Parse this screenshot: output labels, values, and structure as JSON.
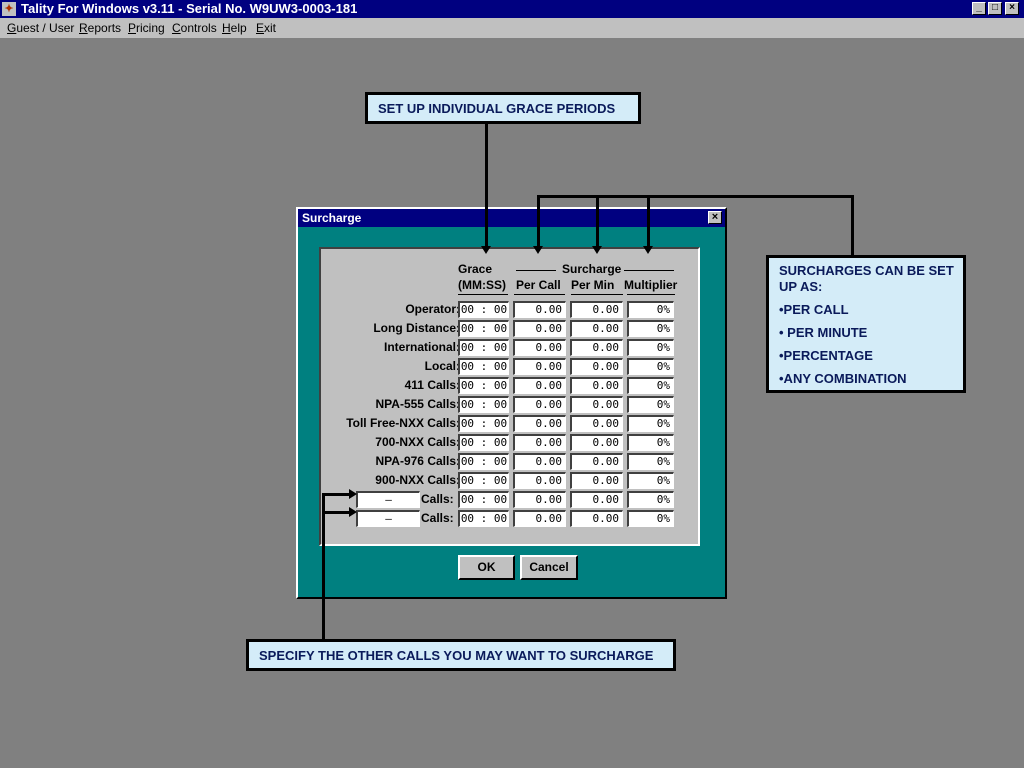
{
  "window": {
    "title": "Tality For Windows v3.11 - Serial No. W9UW3-0003-181",
    "minimize_glyph": "_",
    "maximize_glyph": "□",
    "close_glyph": "×"
  },
  "menu": [
    {
      "key": "G",
      "rest": "uest / User"
    },
    {
      "key": "R",
      "rest": "eports"
    },
    {
      "key": "P",
      "rest": "ricing"
    },
    {
      "key": "C",
      "rest": "ontrols"
    },
    {
      "key": "H",
      "rest": "elp"
    },
    {
      "key": "E",
      "rest": "xit"
    }
  ],
  "callouts": {
    "grace": "SET UP INDIVIDUAL GRACE PERIODS",
    "surcharges_title": "SURCHARGES CAN BE SET UP AS:",
    "surcharges_items": [
      "•PER CALL",
      "• PER MINUTE",
      "•PERCENTAGE",
      "•ANY COMBINATION"
    ],
    "other_calls": "SPECIFY THE OTHER CALLS YOU MAY WANT TO SURCHARGE"
  },
  "dialog": {
    "title": "Surcharge",
    "close_glyph": "×",
    "headers": {
      "grace": "Grace",
      "grace_format": "(MM:SS)",
      "surcharge": "Surcharge",
      "per_call": "Per Call",
      "per_min": "Per Min",
      "multiplier": "Multiplier"
    },
    "rows": [
      {
        "label": "Operator:",
        "grace": "00 : 00",
        "per_call": "0.00",
        "per_min": "0.00",
        "multiplier": "0%"
      },
      {
        "label": "Long Distance:",
        "grace": "00 : 00",
        "per_call": "0.00",
        "per_min": "0.00",
        "multiplier": "0%"
      },
      {
        "label": "International:",
        "grace": "00 : 00",
        "per_call": "0.00",
        "per_min": "0.00",
        "multiplier": "0%"
      },
      {
        "label": "Local:",
        "grace": "00 : 00",
        "per_call": "0.00",
        "per_min": "0.00",
        "multiplier": "0%"
      },
      {
        "label": "411 Calls:",
        "grace": "00 : 00",
        "per_call": "0.00",
        "per_min": "0.00",
        "multiplier": "0%"
      },
      {
        "label": "NPA-555 Calls:",
        "grace": "00 : 00",
        "per_call": "0.00",
        "per_min": "0.00",
        "multiplier": "0%"
      },
      {
        "label": "Toll Free-NXX Calls:",
        "grace": "00 : 00",
        "per_call": "0.00",
        "per_min": "0.00",
        "multiplier": "0%"
      },
      {
        "label": "700-NXX Calls:",
        "grace": "00 : 00",
        "per_call": "0.00",
        "per_min": "0.00",
        "multiplier": "0%"
      },
      {
        "label": "NPA-976 Calls:",
        "grace": "00 : 00",
        "per_call": "0.00",
        "per_min": "0.00",
        "multiplier": "0%"
      },
      {
        "label": "900-NXX Calls:",
        "grace": "00 : 00",
        "per_call": "0.00",
        "per_min": "0.00",
        "multiplier": "0%"
      }
    ],
    "custom_rows": [
      {
        "prefix": "–",
        "label": "Calls:",
        "grace": "00 : 00",
        "per_call": "0.00",
        "per_min": "0.00",
        "multiplier": "0%"
      },
      {
        "prefix": "–",
        "label": "Calls:",
        "grace": "00 : 00",
        "per_call": "0.00",
        "per_min": "0.00",
        "multiplier": "0%"
      }
    ],
    "ok_label": "OK",
    "cancel_label": "Cancel"
  },
  "colors": {
    "desktop": "#808080",
    "titlebar": "#000080",
    "dialog_bg": "#008080",
    "panel": "#c0c0c0",
    "callout_bg": "#d4ecf8",
    "callout_text": "#0a1a5a"
  }
}
